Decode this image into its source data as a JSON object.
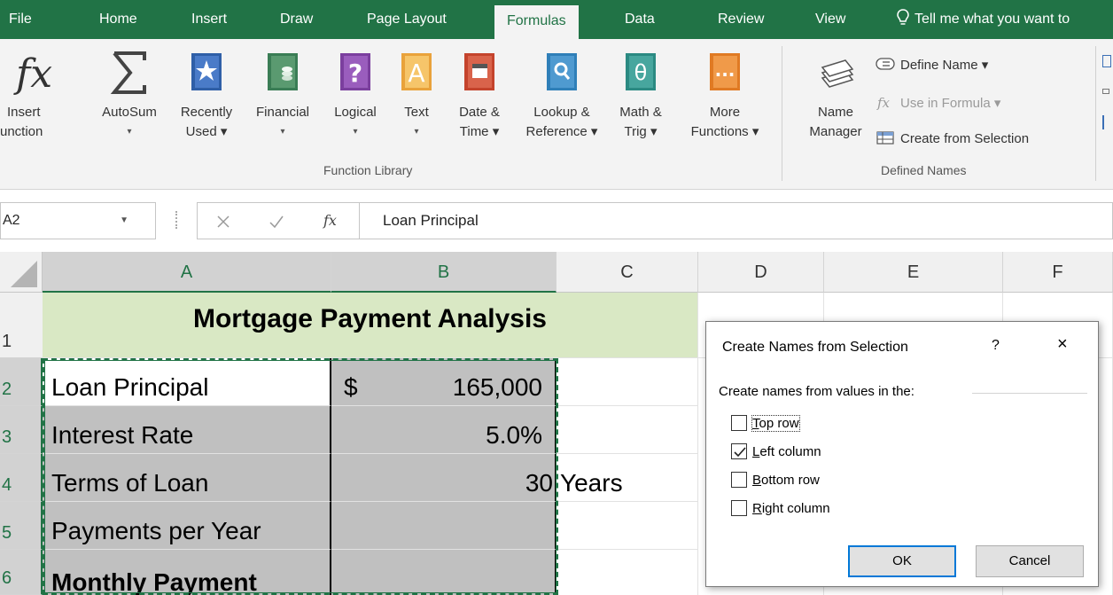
{
  "tabs": {
    "file": "File",
    "home": "Home",
    "insert": "Insert",
    "draw": "Draw",
    "page_layout": "Page Layout",
    "formulas": "Formulas",
    "data": "Data",
    "review": "Review",
    "view": "View",
    "tell_me": "Tell me what you want to"
  },
  "ribbon": {
    "insert_function": {
      "line1": "Insert",
      "line2": "unction"
    },
    "autosum": {
      "line1": "AutoSum",
      "line2": "▾"
    },
    "recently_used": {
      "line1": "Recently",
      "line2": "Used ▾"
    },
    "financial": {
      "line1": "Financial",
      "line2": "▾"
    },
    "logical": {
      "line1": "Logical",
      "line2": "▾"
    },
    "text": {
      "line1": "Text",
      "line2": "▾"
    },
    "date_time": {
      "line1": "Date &",
      "line2": "Time ▾"
    },
    "lookup": {
      "line1": "Lookup &",
      "line2": "Reference ▾"
    },
    "math": {
      "line1": "Math &",
      "line2": "Trig ▾"
    },
    "more": {
      "line1": "More",
      "line2": "Functions ▾"
    },
    "function_library_label": "Function Library",
    "name_manager": {
      "line1": "Name",
      "line2": "Manager"
    },
    "define_name": "Define Name ▾",
    "use_in_formula": "Use in Formula ▾",
    "create_from_selection": "Create from Selection",
    "defined_names_label": "Defined Names"
  },
  "formula_bar": {
    "name_box": "A2",
    "value": "Loan Principal"
  },
  "columns": [
    "A",
    "B",
    "C",
    "D",
    "E",
    "F"
  ],
  "rows": [
    "1",
    "2",
    "3",
    "4",
    "5",
    "6"
  ],
  "cells": {
    "title": "Mortgage Payment Analysis",
    "a2": "Loan Principal",
    "a3": "Interest Rate",
    "a4": "Terms of Loan",
    "a5": "Payments per Year",
    "a6": "Monthly Payment",
    "b2_currency": "$",
    "b2_value": "165,000",
    "b3": "5.0%",
    "b4": "30",
    "c4": "Years"
  },
  "dialog": {
    "title": "Create Names from Selection",
    "help": "?",
    "close": "×",
    "group_label": "Create names from values in the:",
    "options": [
      {
        "mnemonic": "T",
        "rest": "op row",
        "checked": false
      },
      {
        "mnemonic": "L",
        "rest": "eft column",
        "checked": true
      },
      {
        "mnemonic": "B",
        "rest": "ottom row",
        "checked": false
      },
      {
        "mnemonic": "R",
        "rest": "ight column",
        "checked": false
      }
    ],
    "ok": "OK",
    "cancel": "Cancel"
  },
  "colors": {
    "accent": "#217346",
    "title_fill": "#d9e8c4",
    "selection_fill": "#c0c0c0",
    "default_button_border": "#0078d7"
  }
}
